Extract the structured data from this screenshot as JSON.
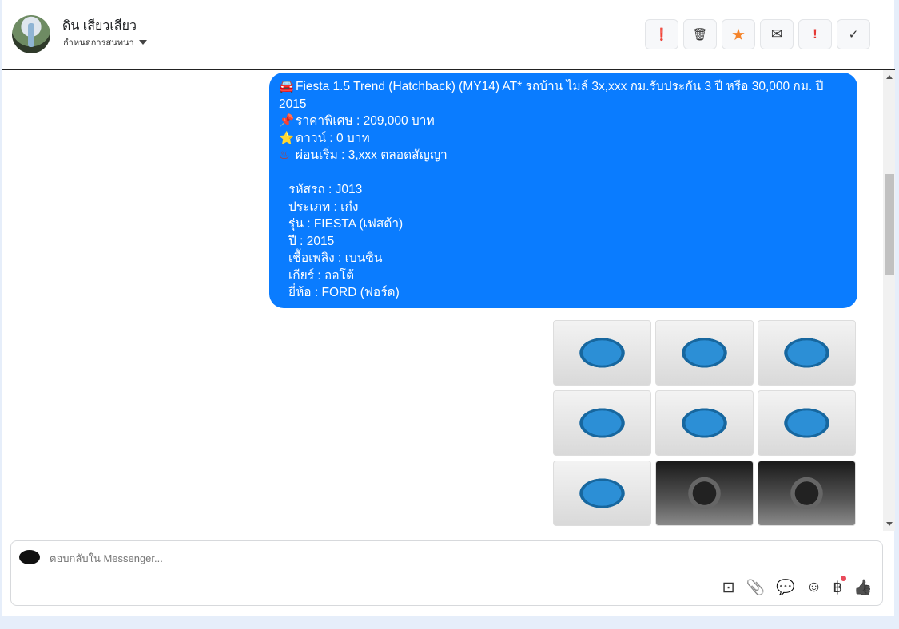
{
  "header": {
    "name": "ดิน เสียวเสียว",
    "assign_label": "กำหนดการสนทนา"
  },
  "actions": [
    {
      "name": "mark-spam",
      "glyph": "❗"
    },
    {
      "name": "delete",
      "glyph": "🗑"
    },
    {
      "name": "star",
      "glyph": "★"
    },
    {
      "name": "mark-unread",
      "glyph": "✉"
    },
    {
      "name": "follow-up",
      "glyph": "!"
    },
    {
      "name": "done",
      "glyph": "✓"
    }
  ],
  "message": {
    "title": "Fiesta 1.5 Trend (Hatchback) (MY14) AT* รถบ้าน ไมล์ 3x,xxx กม.รับประกัน 3 ปี หรือ 30,000 กม. ปี 2015",
    "price": "ราคาพิเศษ : 209,000 บาท",
    "down": "ดาวน์ : 0 บาท",
    "installment": "ผ่อนเริ่ม : 3,xxx ตลอดสัญญา",
    "details": [
      "รหัสรถ : J013",
      "ประเภท : เก๋ง",
      "รุ่น : FIESTA (เฟสต้า)",
      "ปี : 2015",
      "เชื้อเพลิง : เบนซิน",
      "เกียร์ : ออโต้",
      "ยี่ห้อ : FORD (ฟอร์ด)"
    ],
    "emoji": {
      "car": "🚘",
      "pin": "📌",
      "star": "⭐",
      "hot": "♨"
    }
  },
  "photos": [
    "exterior",
    "exterior",
    "exterior",
    "exterior",
    "exterior",
    "exterior",
    "exterior",
    "interior",
    "interior"
  ],
  "composer": {
    "placeholder": "ตอบกลับใน Messenger...",
    "tools": {
      "saved": "⊡",
      "attach": "📎",
      "chat": "💬",
      "emoji": "☺",
      "payment": "฿",
      "like": "👍"
    }
  },
  "colors": {
    "bubble": "#0a7cff",
    "star": "#f5842b",
    "alert": "#e53935"
  }
}
